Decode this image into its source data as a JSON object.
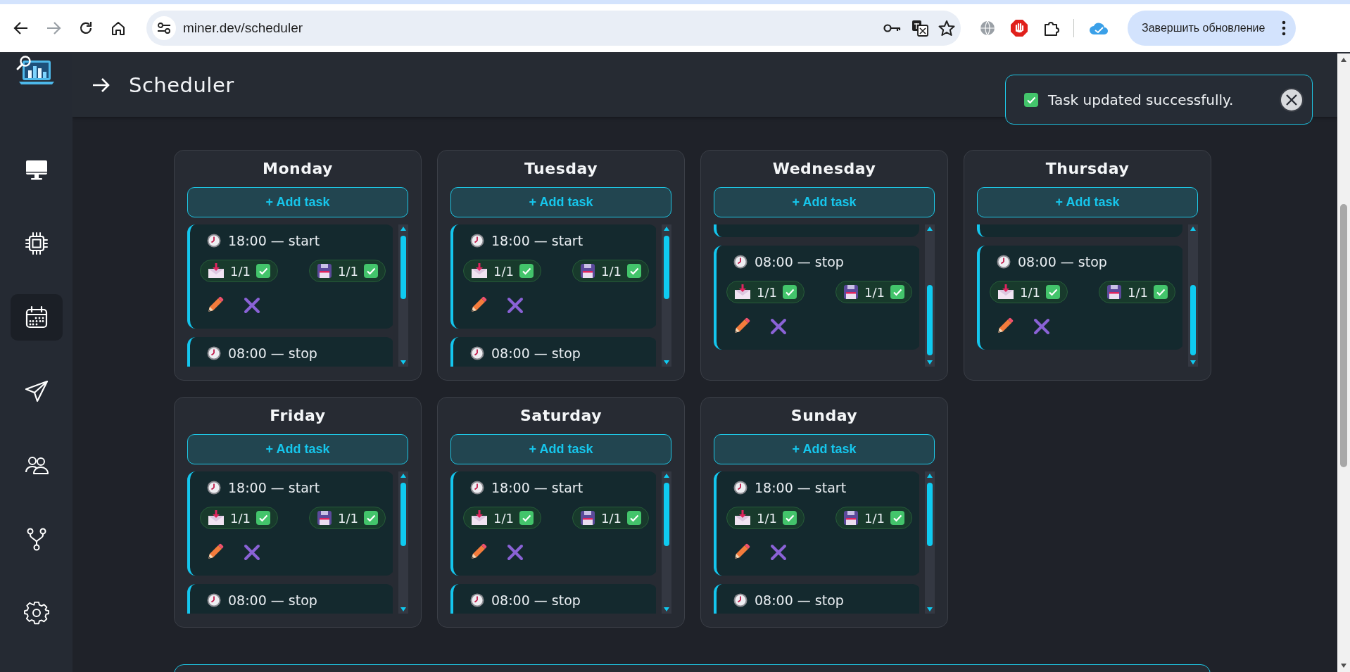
{
  "browser": {
    "url": "miner.dev/scheduler",
    "update_button": "Завершить обновление"
  },
  "sidebar": {
    "items": [
      {
        "kind": "monitor",
        "selected": false
      },
      {
        "kind": "chip",
        "selected": false
      },
      {
        "kind": "calendar",
        "selected": true
      },
      {
        "kind": "send",
        "selected": false
      },
      {
        "kind": "users",
        "selected": false
      },
      {
        "kind": "branch",
        "selected": false
      },
      {
        "kind": "settings",
        "selected": false
      }
    ]
  },
  "header": {
    "title": "Scheduler"
  },
  "toast": {
    "message": "Task updated successfully."
  },
  "days": [
    {
      "name": "Monday",
      "add_label": "+ Add task",
      "scrolled": false,
      "tasks": [
        {
          "time": "18:00 — start",
          "received": "1/1",
          "received_done": true,
          "saved": "1/1",
          "saved_done": true
        },
        {
          "time": "08:00 — stop"
        }
      ]
    },
    {
      "name": "Tuesday",
      "add_label": "+ Add task",
      "scrolled": false,
      "tasks": [
        {
          "time": "18:00 — start",
          "received": "1/1",
          "received_done": true,
          "saved": "1/1",
          "saved_done": true
        },
        {
          "time": "08:00 — stop"
        }
      ]
    },
    {
      "name": "Wednesday",
      "add_label": "+ Add task",
      "scrolled": true,
      "tasks": [
        {
          "time": "08:00 — stop",
          "received": "1/1",
          "received_done": true,
          "saved": "1/1",
          "saved_done": true
        }
      ]
    },
    {
      "name": "Thursday",
      "add_label": "+ Add task",
      "scrolled": true,
      "tasks": [
        {
          "time": "08:00 — stop",
          "received": "1/1",
          "received_done": true,
          "saved": "1/1",
          "saved_done": true
        }
      ]
    },
    {
      "name": "Friday",
      "add_label": "+ Add task",
      "scrolled": false,
      "tasks": [
        {
          "time": "18:00 — start",
          "received": "1/1",
          "received_done": true,
          "saved": "1/1",
          "saved_done": true
        },
        {
          "time": "08:00 — stop"
        }
      ]
    },
    {
      "name": "Saturday",
      "add_label": "+ Add task",
      "scrolled": false,
      "tasks": [
        {
          "time": "18:00 — start",
          "received": "1/1",
          "received_done": true,
          "saved": "1/1",
          "saved_done": true
        },
        {
          "time": "08:00 — stop"
        }
      ]
    },
    {
      "name": "Sunday",
      "add_label": "+ Add task",
      "scrolled": false,
      "tasks": [
        {
          "time": "18:00 — start",
          "received": "1/1",
          "received_done": true,
          "saved": "1/1",
          "saved_done": true
        },
        {
          "time": "08:00 — stop"
        }
      ]
    }
  ]
}
